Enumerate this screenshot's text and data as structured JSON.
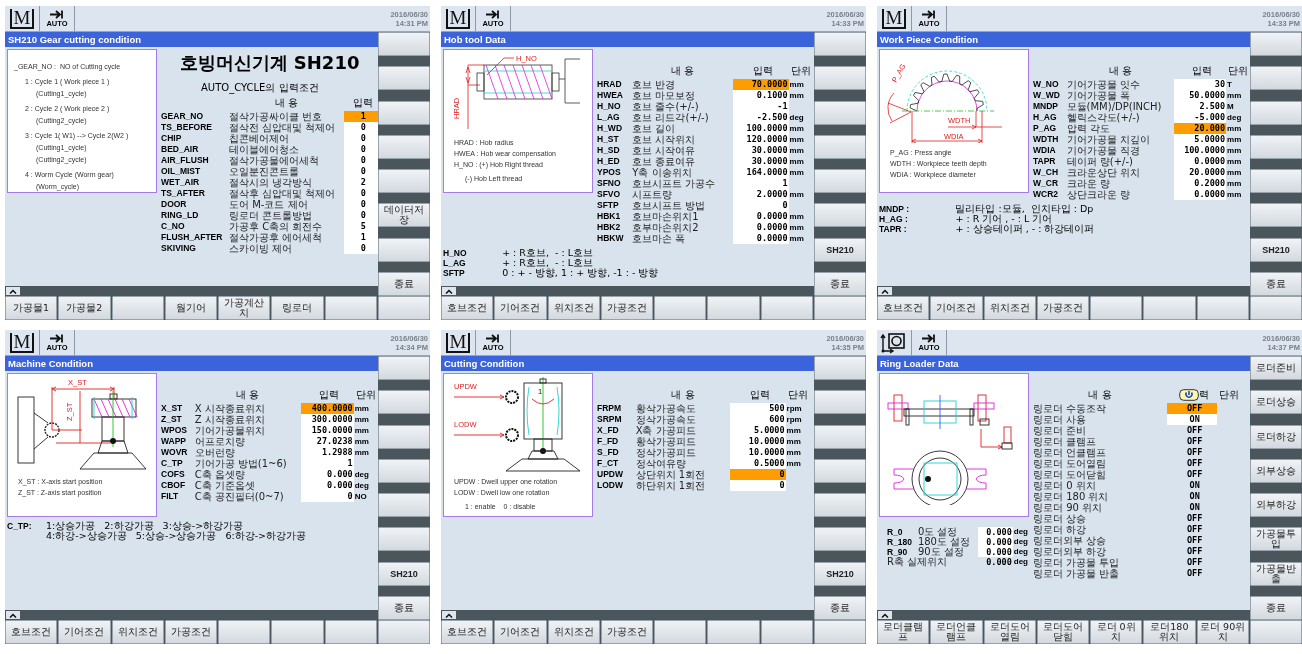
{
  "panels": [
    {
      "mode": {
        "kind": "machine",
        "glyph": "M"
      },
      "op_mode": "AUTO",
      "date": "2016/06/30",
      "time": "14:31 PM",
      "title": "SH210 Gear cutting condition",
      "diagram": {
        "legend": [
          {
            "text": "_GEAR_NO :  NO of Cutting cycle",
            "children": [
              {
                "text": "1 : Cycle 1 ( Work piece 1 )",
                "children": [
                  {
                    "text": "(Cutting1_cycle)"
                  }
                ]
              },
              {
                "text": "2 : Cycle 2 ( Work piece 2 )",
                "children": [
                  {
                    "text": "(Cutting2_cycle)"
                  }
                ]
              },
              {
                "text": "3 : Cycle 1( W1) --> Cycle 2(W2 )",
                "children": [
                  {
                    "text": "(Cutting1_cycle)"
                  },
                  {
                    "text": "(Cutting2_cycle)"
                  }
                ]
              },
              {
                "text": "4 : Worm Cycle (Worm gear)",
                "children": [
                  {
                    "text": "(Worm_cycle)"
                  }
                ]
              }
            ]
          }
        ]
      },
      "heading": "호빙머신기계 SH210",
      "subheading": "AUTO_CYCLE의 입력조건",
      "columns": {
        "content": "내 용",
        "input": "입력"
      },
      "rows": [
        {
          "code": "GEAR_NO",
          "desc": "절삭가공싸이클 번호",
          "value": "1",
          "selected": true,
          "editable": true
        },
        {
          "code": "TS_BEFORE",
          "desc": "절삭전 심압대및 척제어",
          "value": "0",
          "selected": false,
          "editable": true
        },
        {
          "code": "CHIP",
          "desc": "칩콘베어제어",
          "value": "0",
          "selected": false,
          "editable": true
        },
        {
          "code": "BED_AIR",
          "desc": "테이블에어청소",
          "value": "0",
          "selected": false,
          "editable": true
        },
        {
          "code": "AIR_FLUSH",
          "desc": "절삭가공물에어세척",
          "value": "0",
          "selected": false,
          "editable": true
        },
        {
          "code": "OIL_MIST",
          "desc": "오일분진콘트롤",
          "value": "0",
          "selected": false,
          "editable": true
        },
        {
          "code": "WET_AIR",
          "desc": "절삭시의 냉각방식",
          "value": "2",
          "selected": false,
          "editable": true
        },
        {
          "code": "TS_AFTER",
          "desc": "절삭후 심압대및 척제어",
          "value": "0",
          "selected": false,
          "editable": true
        },
        {
          "code": "DOOR",
          "desc": "도어 M-코드 제어",
          "value": "0",
          "selected": false,
          "editable": true
        },
        {
          "code": "RING_LD",
          "desc": "링로더 콘트롤방법",
          "value": "0",
          "selected": false,
          "editable": true
        },
        {
          "code": "C_NO",
          "desc": "가공후 C축의 회전수",
          "value": "5",
          "selected": false,
          "editable": true
        },
        {
          "code": "FLUSH_AFTER",
          "desc": "절삭가공후 에어세척",
          "value": "1",
          "selected": false,
          "editable": true
        },
        {
          "code": "SKIVING",
          "desc": "스카이빙 제어",
          "value": "0",
          "selected": false,
          "editable": true
        }
      ],
      "side_buttons": [
        {
          "kind": "blank"
        },
        {
          "kind": "blank"
        },
        {
          "kind": "blank"
        },
        {
          "kind": "blank"
        },
        {
          "kind": "blank"
        },
        {
          "kind": "text",
          "label": "데이터저장"
        },
        {
          "kind": "blank"
        },
        {
          "kind": "text",
          "label": "종료"
        }
      ],
      "soft_keys": [
        {
          "kind": "text",
          "label": "가공물1"
        },
        {
          "kind": "text",
          "label": "가공물2"
        },
        {
          "kind": "blank"
        },
        {
          "kind": "text",
          "label": "웜기어"
        },
        {
          "kind": "text",
          "label": "가공계산치"
        },
        {
          "kind": "text",
          "label": "링로더"
        },
        {
          "kind": "blank"
        },
        {
          "kind": "blank"
        }
      ]
    },
    {
      "mode": {
        "kind": "machine",
        "glyph": "M"
      },
      "op_mode": "AUTO",
      "date": "2016/06/30",
      "time": "14:33 PM",
      "title": "Hob tool Data",
      "diagram": {
        "kind": "hob",
        "labels": [
          "H_NO",
          "HRAD"
        ],
        "legend": [
          {
            "text": "HRAD : Hob radius"
          },
          {
            "text": "HWEA : Hob wear compensation"
          },
          {
            "text": "H_NO : (+) Hob Right thread",
            "children": [
              {
                "text": "(-) Hob Left thread"
              }
            ]
          }
        ]
      },
      "columns": {
        "content": "내 용",
        "input": "입력",
        "unit": "단위"
      },
      "rows": [
        {
          "code": "HRAD",
          "desc": "호브 반경",
          "value": "70.0000",
          "unit": "mm",
          "selected": true,
          "editable": true
        },
        {
          "code": "HWEA",
          "desc": "호브 마모보정",
          "value": "0.1000",
          "unit": "mm",
          "selected": false,
          "editable": true
        },
        {
          "code": "H_NO",
          "desc": "호브 줄수(+/-)",
          "value": "-1",
          "selected": false,
          "editable": true
        },
        {
          "code": "L_AG",
          "desc": "호브 리드각(+/-)",
          "value": "-2.500",
          "unit": "deg",
          "selected": false,
          "editable": true
        },
        {
          "code": "H_WD",
          "desc": "호브 길이",
          "value": "100.0000",
          "unit": "mm",
          "selected": false,
          "editable": true
        },
        {
          "code": "H_ST",
          "desc": "호브 시작위치",
          "value": "120.0000",
          "unit": "mm",
          "selected": false,
          "editable": true
        },
        {
          "code": "H_SD",
          "desc": "호브 시작여유",
          "value": "30.0000",
          "unit": "mm",
          "selected": false,
          "editable": true
        },
        {
          "code": "H_ED",
          "desc": "호브 종료여유",
          "value": "30.0000",
          "unit": "mm",
          "selected": false,
          "editable": true
        },
        {
          "code": "YPOS",
          "desc": "Y축 이송위치",
          "value": "164.0000",
          "unit": "mm",
          "selected": false,
          "editable": true
        },
        {
          "code": "SFNO",
          "desc": "호브시프트 가공수",
          "value": "1",
          "selected": false,
          "editable": true
        },
        {
          "code": "SFVO",
          "desc": "시프트량",
          "value": "2.0000",
          "unit": "mm",
          "selected": false,
          "editable": true
        },
        {
          "code": "SFTP",
          "desc": "호브시프트 방법",
          "value": "0",
          "selected": false,
          "editable": true
        },
        {
          "code": "HBK1",
          "desc": "호브마손위치1",
          "value": "0.0000",
          "unit": "mm",
          "selected": false,
          "editable": true
        },
        {
          "code": "HBK2",
          "desc": "호부마손위치2",
          "value": "0.0000",
          "unit": "mm",
          "selected": false,
          "editable": true
        },
        {
          "code": "HBKW",
          "desc": "호브마손 폭",
          "value": "0.0000",
          "unit": "mm",
          "selected": false,
          "editable": true
        }
      ],
      "notes": [
        {
          "code": "H_NO",
          "text": "+ : R호브,  - : L호브"
        },
        {
          "code": "L_AG",
          "text": "+ : R호브,  - : L호브"
        },
        {
          "code": "SFTP",
          "text": "0 : + - 방향, 1 : + 방향, -1 : - 방향"
        }
      ],
      "side_buttons": [
        {
          "kind": "blank"
        },
        {
          "kind": "blank"
        },
        {
          "kind": "blank"
        },
        {
          "kind": "blank"
        },
        {
          "kind": "blank"
        },
        {
          "kind": "blank"
        },
        {
          "kind": "text",
          "label": "SH210"
        },
        {
          "kind": "text",
          "label": "종료"
        }
      ],
      "soft_keys": [
        {
          "kind": "text",
          "label": "호브조건"
        },
        {
          "kind": "text",
          "label": "기어조건"
        },
        {
          "kind": "text",
          "label": "위치조건"
        },
        {
          "kind": "text",
          "label": "가공조건"
        },
        {
          "kind": "blank"
        },
        {
          "kind": "blank"
        },
        {
          "kind": "blank"
        },
        {
          "kind": "blank"
        }
      ]
    },
    {
      "mode": {
        "kind": "machine",
        "glyph": "M"
      },
      "op_mode": "AUTO",
      "date": "2016/06/30",
      "time": "14:33 PM",
      "title": "Work Piece Condition",
      "diagram": {
        "kind": "gear",
        "labels": [
          "P_AG",
          "WDTH",
          "WDIA"
        ],
        "legend": [
          {
            "text": "P_AG : Press angle"
          },
          {
            "text": "WDTH : Workpiece teeth depth"
          },
          {
            "text": "WDIA : Workpiece diameter"
          }
        ]
      },
      "columns": {
        "content": "내 용",
        "input": "입력",
        "unit": "단위"
      },
      "rows": [
        {
          "code": "W_NO",
          "desc": "기어가공물 잇수",
          "value": "30",
          "unit": "T",
          "selected": false,
          "editable": true
        },
        {
          "code": "W_WD",
          "desc": "기어가공물 폭",
          "value": "50.0000",
          "unit": "mm",
          "selected": false,
          "editable": true
        },
        {
          "code": "MNDP",
          "desc": "모듈(MM)/DP(INCH)",
          "value": "2.500",
          "unit": "M",
          "selected": false,
          "editable": true
        },
        {
          "code": "H_AG",
          "desc": "헬릭스각도(+/-)",
          "value": "-5.000",
          "unit": "deg",
          "selected": false,
          "editable": true
        },
        {
          "code": "P_AG",
          "desc": "압력 각도",
          "value": "20.000",
          "unit": "mm",
          "selected": true,
          "editable": true
        },
        {
          "code": "WDTH",
          "desc": "기어가공물 치깊이",
          "value": "5.0000",
          "unit": "mm",
          "selected": false,
          "editable": true
        },
        {
          "code": "WDIA",
          "desc": "기어가공물 직경",
          "value": "100.0000",
          "unit": "mm",
          "selected": false,
          "editable": true
        },
        {
          "code": "TAPR",
          "desc": "테이퍼 량(+/-)",
          "value": "0.0000",
          "unit": "mm",
          "selected": false,
          "editable": true
        },
        {
          "code": "W_CH",
          "desc": "크라운상단 위치",
          "value": "20.0000",
          "unit": "mm",
          "selected": false,
          "editable": true
        },
        {
          "code": "W_CR",
          "desc": "크라운 량",
          "value": "0.2000",
          "unit": "mm",
          "selected": false,
          "editable": true
        },
        {
          "code": "WCR2",
          "desc": "상단크라운 량",
          "value": "0.0000",
          "unit": "mm",
          "selected": false,
          "editable": true
        }
      ],
      "notes": [
        {
          "code": "MNDP :",
          "text": "밀리타입 :모듈,  인치타입 : Dp"
        },
        {
          "code": "H_AG :",
          "text": "+ : R 기어 , - : L 기어"
        },
        {
          "code": "TAPR :",
          "text": "+ : 상승테이퍼 , - : 하강테이퍼"
        }
      ],
      "side_buttons": [
        {
          "kind": "blank"
        },
        {
          "kind": "blank"
        },
        {
          "kind": "blank"
        },
        {
          "kind": "blank"
        },
        {
          "kind": "blank"
        },
        {
          "kind": "blank"
        },
        {
          "kind": "text",
          "label": "SH210"
        },
        {
          "kind": "text",
          "label": "종료"
        }
      ],
      "soft_keys": [
        {
          "kind": "text",
          "label": "호브조건"
        },
        {
          "kind": "text",
          "label": "기어조건"
        },
        {
          "kind": "text",
          "label": "위치조건"
        },
        {
          "kind": "text",
          "label": "가공조건"
        },
        {
          "kind": "blank"
        },
        {
          "kind": "blank"
        },
        {
          "kind": "blank"
        },
        {
          "kind": "blank"
        }
      ]
    },
    {
      "mode": {
        "kind": "machine",
        "glyph": "M"
      },
      "op_mode": "AUTO",
      "date": "2016/06/30",
      "time": "14:34 PM",
      "title": "Machine Condition",
      "diagram": {
        "kind": "machine",
        "labels": [
          "X_ST",
          "Z_ST"
        ],
        "legend": [
          {
            "text": "X_ST : X-axis start position"
          },
          {
            "text": "Z_ST : Z-axis start position"
          }
        ]
      },
      "columns": {
        "content": "내 용",
        "input": "입력",
        "unit": "단위"
      },
      "rows": [
        {
          "code": "X_ST",
          "desc": "X 시작종료위치",
          "value": "400.0000",
          "unit": "mm",
          "selected": true,
          "editable": true
        },
        {
          "code": "Z_ST",
          "desc": "Z 시작종료위치",
          "value": "300.0000",
          "unit": "mm",
          "selected": false,
          "editable": true
        },
        {
          "code": "WPOS",
          "desc": "기어가공물위치",
          "value": "150.0000",
          "unit": "mm",
          "selected": false,
          "editable": true
        },
        {
          "code": "WAPP",
          "desc": "어프로치량",
          "value": "27.0238",
          "unit": "mm",
          "selected": false,
          "editable": true
        },
        {
          "code": "WOVR",
          "desc": "오버런량",
          "value": "1.2988",
          "unit": "mm",
          "selected": false,
          "editable": true
        },
        {
          "code": "C_TP",
          "desc": "기어가공 방법(1~6)",
          "value": "1",
          "selected": false,
          "editable": true
        },
        {
          "code": "COFS",
          "desc": "C축 옵셋량",
          "value": "0.000",
          "unit": "deg",
          "selected": false,
          "editable": true
        },
        {
          "code": "CBOF",
          "desc": "C축 기준옵셋",
          "value": "0.000",
          "unit": "deg",
          "selected": false,
          "editable": true
        },
        {
          "code": "FILT",
          "desc": "C축 공진필터(0~7)",
          "value": "0",
          "unit": "NO",
          "selected": false,
          "editable": true
        }
      ],
      "notes": [
        {
          "code": "C_TP:",
          "text": "1:상승가공   2:하강가공   3:상승->하강가공"
        },
        {
          "text": "4:하강->상승가공   5:상승->상승가공   6:하강->하강가공"
        }
      ],
      "side_buttons": [
        {
          "kind": "blank"
        },
        {
          "kind": "blank"
        },
        {
          "kind": "blank"
        },
        {
          "kind": "blank"
        },
        {
          "kind": "blank"
        },
        {
          "kind": "blank"
        },
        {
          "kind": "text",
          "label": "SH210"
        },
        {
          "kind": "text",
          "label": "종료"
        }
      ],
      "soft_keys": [
        {
          "kind": "text",
          "label": "호브조건"
        },
        {
          "kind": "text",
          "label": "기어조건"
        },
        {
          "kind": "text",
          "label": "위치조건"
        },
        {
          "kind": "text",
          "label": "가공조건"
        },
        {
          "kind": "blank"
        },
        {
          "kind": "blank"
        },
        {
          "kind": "blank"
        },
        {
          "kind": "blank"
        }
      ]
    },
    {
      "mode": {
        "kind": "machine",
        "glyph": "M"
      },
      "op_mode": "AUTO",
      "date": "2016/06/30",
      "time": "14:35 PM",
      "title": "Cutting Condition",
      "diagram": {
        "kind": "cutting",
        "labels": [
          "UPDW",
          "LODW",
          "1"
        ],
        "legend": [
          {
            "text": "UPDW : Dwell upper one rotation"
          },
          {
            "text": "LODW : Dwell low one rotation",
            "children": [
              {
                "text": "1 : enable    0 : disable"
              }
            ]
          }
        ]
      },
      "columns": {
        "content": "내 용",
        "input": "입력",
        "unit": "단위"
      },
      "rows": [
        {
          "code": "FRPM",
          "desc": "황삭가공속도",
          "value": "500",
          "unit": "rpm",
          "selected": false,
          "editable": true
        },
        {
          "code": "SRPM",
          "desc": "정삭가공속도",
          "value": "600",
          "unit": "rpm",
          "selected": false,
          "editable": true
        },
        {
          "code": "X_FD",
          "desc": "X축 가공피드",
          "value": "5.0000",
          "unit": "mm",
          "selected": false,
          "editable": true
        },
        {
          "code": "F_FD",
          "desc": "황삭가공피드",
          "value": "10.0000",
          "unit": "mm",
          "selected": false,
          "editable": true
        },
        {
          "code": "S_FD",
          "desc": "정삭가공피드",
          "value": "10.0000",
          "unit": "mm",
          "selected": false,
          "editable": true
        },
        {
          "code": "F_CT",
          "desc": "정삭여유량",
          "value": "0.5000",
          "unit": "mm",
          "selected": false,
          "editable": true
        },
        {
          "code": "UPDW",
          "desc": "상단위치 1회전",
          "value": "0",
          "selected": true,
          "editable": true
        },
        {
          "code": "LODW",
          "desc": "하단위치 1회전",
          "value": "0",
          "selected": false,
          "editable": true
        }
      ],
      "side_buttons": [
        {
          "kind": "blank"
        },
        {
          "kind": "blank"
        },
        {
          "kind": "blank"
        },
        {
          "kind": "blank"
        },
        {
          "kind": "blank"
        },
        {
          "kind": "blank"
        },
        {
          "kind": "text",
          "label": "SH210"
        },
        {
          "kind": "text",
          "label": "종료"
        }
      ],
      "soft_keys": [
        {
          "kind": "text",
          "label": "호브조건"
        },
        {
          "kind": "text",
          "label": "기어조건"
        },
        {
          "kind": "text",
          "label": "위치조건"
        },
        {
          "kind": "text",
          "label": "가공조건"
        },
        {
          "kind": "blank"
        },
        {
          "kind": "blank"
        },
        {
          "kind": "blank"
        },
        {
          "kind": "blank"
        }
      ]
    },
    {
      "mode": {
        "kind": "jog"
      },
      "op_mode": "AUTO",
      "date": "2016/06/30",
      "time": "14:37 PM",
      "title": "Ring Loader Data",
      "diagram": {
        "kind": "ringloader"
      },
      "offsets": [
        {
          "code": "R_0",
          "desc": "0도 설정",
          "value": "0.000",
          "unit": "deg",
          "editable": true
        },
        {
          "code": "R_180",
          "desc": "180도 설정",
          "value": "0.000",
          "unit": "deg",
          "editable": true
        },
        {
          "code": "R_90",
          "desc": "90도 설정",
          "value": "0.000",
          "unit": "deg",
          "editable": true
        },
        {
          "desc": "R축 실제위치",
          "value": "0.000",
          "unit": "deg",
          "editable": false
        }
      ],
      "columns": {
        "content": "내 용",
        "input": "력",
        "unit": "단위",
        "input_badge": true
      },
      "rows": [
        {
          "desc": "링로더 수동조작",
          "value": "OFF",
          "selected": true,
          "editable": true
        },
        {
          "desc": "링로더 사용",
          "value": "ON",
          "selected": false,
          "editable": true
        },
        {
          "desc": "링로더 준비",
          "value": "OFF",
          "selected": false,
          "editable": false
        },
        {
          "desc": "링로더 클램프",
          "value": "OFF",
          "selected": false,
          "editable": false
        },
        {
          "desc": "링로더 언클램프",
          "value": "OFF",
          "selected": false,
          "editable": false
        },
        {
          "desc": "링로더 도어열림",
          "value": "OFF",
          "selected": false,
          "editable": false
        },
        {
          "desc": "링로더 도어닫힘",
          "value": "OFF",
          "selected": false,
          "editable": false
        },
        {
          "desc": "링로더 0 위치",
          "value": "ON",
          "selected": false,
          "editable": false
        },
        {
          "desc": "링로더 180 위치",
          "value": "ON",
          "selected": false,
          "editable": false
        },
        {
          "desc": "링로더 90 위치",
          "value": "ON",
          "selected": false,
          "editable": false
        },
        {
          "desc": "링로더 상승",
          "value": "OFF",
          "selected": false,
          "editable": false
        },
        {
          "desc": "링로더 하강",
          "value": "OFF",
          "selected": false,
          "editable": false
        },
        {
          "desc": "링로더외부 상승",
          "value": "OFF",
          "selected": false,
          "editable": false
        },
        {
          "desc": "링로더외부 하강",
          "value": "OFF",
          "selected": false,
          "editable": false
        },
        {
          "desc": "링로더 가공물 투입",
          "value": "OFF",
          "selected": false,
          "editable": false
        },
        {
          "desc": "링로더 가공물 반출",
          "value": "OFF",
          "selected": false,
          "editable": false
        }
      ],
      "side_buttons": [
        {
          "kind": "text",
          "label": "로더준비"
        },
        {
          "kind": "text",
          "label": "로더상승"
        },
        {
          "kind": "text",
          "label": "로더하강"
        },
        {
          "kind": "text",
          "label": "외부상승"
        },
        {
          "kind": "text",
          "label": "외부하강"
        },
        {
          "kind": "text",
          "label": "가공물투입"
        },
        {
          "kind": "text",
          "label": "가공물반출"
        },
        {
          "kind": "text",
          "label": "종료"
        }
      ],
      "soft_keys": [
        {
          "kind": "text",
          "label": "로더클램프"
        },
        {
          "kind": "text",
          "label": "로더언클램프"
        },
        {
          "kind": "text",
          "label": "로더도어열림"
        },
        {
          "kind": "text",
          "label": "로더도어닫힘"
        },
        {
          "kind": "text",
          "label": "로더 0위치"
        },
        {
          "kind": "text",
          "label": "로더180위치"
        },
        {
          "kind": "text",
          "label": "로더 90위치"
        },
        {
          "kind": "blank"
        }
      ]
    }
  ]
}
